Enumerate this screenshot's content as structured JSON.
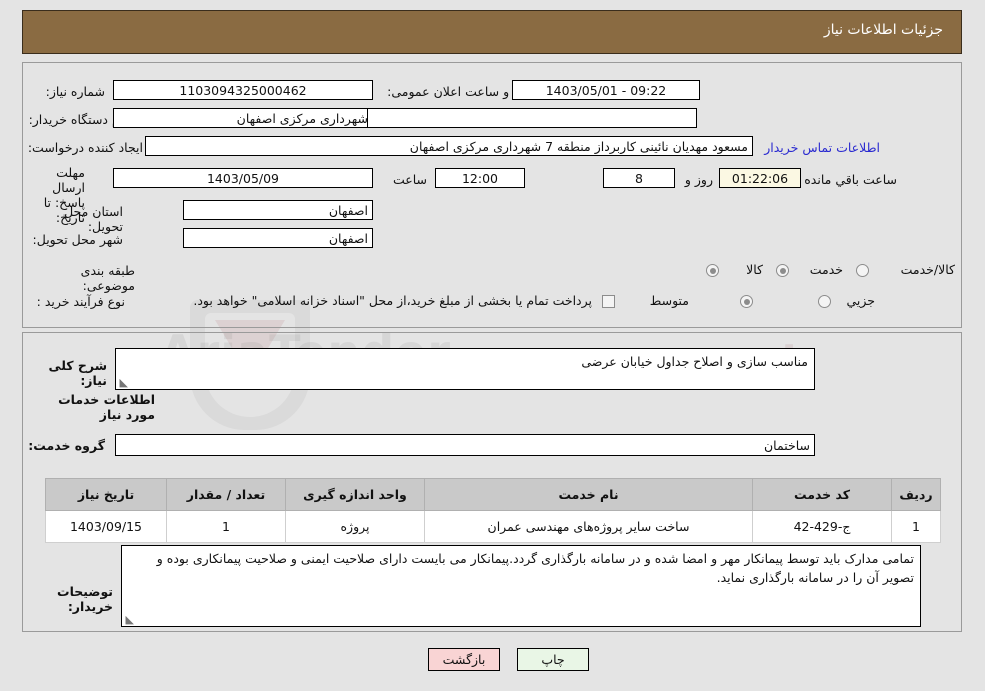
{
  "header": {
    "title": "جزئیات اطلاعات نیاز"
  },
  "fields": {
    "need_number_label": "شماره نیاز:",
    "need_number_value": "1103094325000462",
    "announce_label": "تاریخ و ساعت اعلان عمومی:",
    "announce_value": "09:22 - 1403/05/01",
    "buyer_org_label": "نام دستگاه خریدار:",
    "buyer_org_value": "شهرداری مرکزی اصفهان",
    "buyer_org_value2": "",
    "requester_label": "ایجاد کننده درخواست:",
    "requester_value": "مسعود مهدیان نائینی کاربرداز منطقه 7 شهرداری مرکزی اصفهان",
    "contact_link": "اطلاعات تماس خریدار",
    "deadline_label": "مهلت ارسال پاسخ: تا تاریخ:",
    "deadline_date": "1403/05/09",
    "hour_label": "ساعت",
    "deadline_time": "12:00",
    "days_value": "8",
    "days_label": "روز و",
    "countdown_value": "01:22:06",
    "remaining_label": "ساعت باقي مانده",
    "province_label": "استان محل تحویل:",
    "province_value": "اصفهان",
    "city_label": "شهر محل تحویل:",
    "city_value": "اصفهان",
    "category_label": "طبقه بندی موضوعی:",
    "category_options": [
      "کالا",
      "خدمت",
      "کالا/خدمت"
    ],
    "category_selected": "خدمت",
    "process_label": "نوع فرآیند خرید :",
    "process_options": [
      "جزیي",
      "متوسط"
    ],
    "process_selected": "متوسط",
    "treasury_note": "پرداخت تمام یا بخشی از مبلغ خرید،از محل \"اسناد خزانه اسلامی\" خواهد بود.",
    "treasury_checked": false
  },
  "description": {
    "general_label": "شرح کلی نیاز:",
    "general_value": "مناسب سازی و اصلاح جداول خیابان عرضی",
    "section_title": "اطلاعات خدمات مورد نیاز",
    "service_group_label": "گروه خدمت:",
    "service_group_value": "ساختمان",
    "buyer_notes_label": "توضیحات خریدار:",
    "buyer_notes_value": "تمامی مدارک باید توسط پیمانکار مهر و امضا شده و در سامانه بارگذاری گردد.پیمانکار می بایست دارای صلاحیت ایمنی و صلاحیت پیمانکاری بوده و تصویر آن را در سامانه بارگذاری نماید."
  },
  "table": {
    "columns": [
      "ردیف",
      "کد خدمت",
      "نام خدمت",
      "واحد اندازه گیری",
      "تعداد / مقدار",
      "تاریخ نیاز"
    ],
    "rows": [
      {
        "row": "1",
        "code": "ج-429-42",
        "name": "ساخت سایر پروژه‌های مهندسی عمران",
        "unit": "پروژه",
        "qty": "1",
        "date": "1403/09/15"
      }
    ]
  },
  "buttons": {
    "print": "چاپ",
    "back": "بازگشت"
  },
  "watermark": {
    "text_a": "AriaTender",
    "text_b": ".net"
  },
  "colors": {
    "header_bg": "#8a6b42",
    "page_bg": "#e4e4e4",
    "link": "#2a2ad0",
    "print_btn": "#e9f6e6",
    "back_btn": "#f9d4d4",
    "countdown_bg": "#fbf8e3"
  }
}
